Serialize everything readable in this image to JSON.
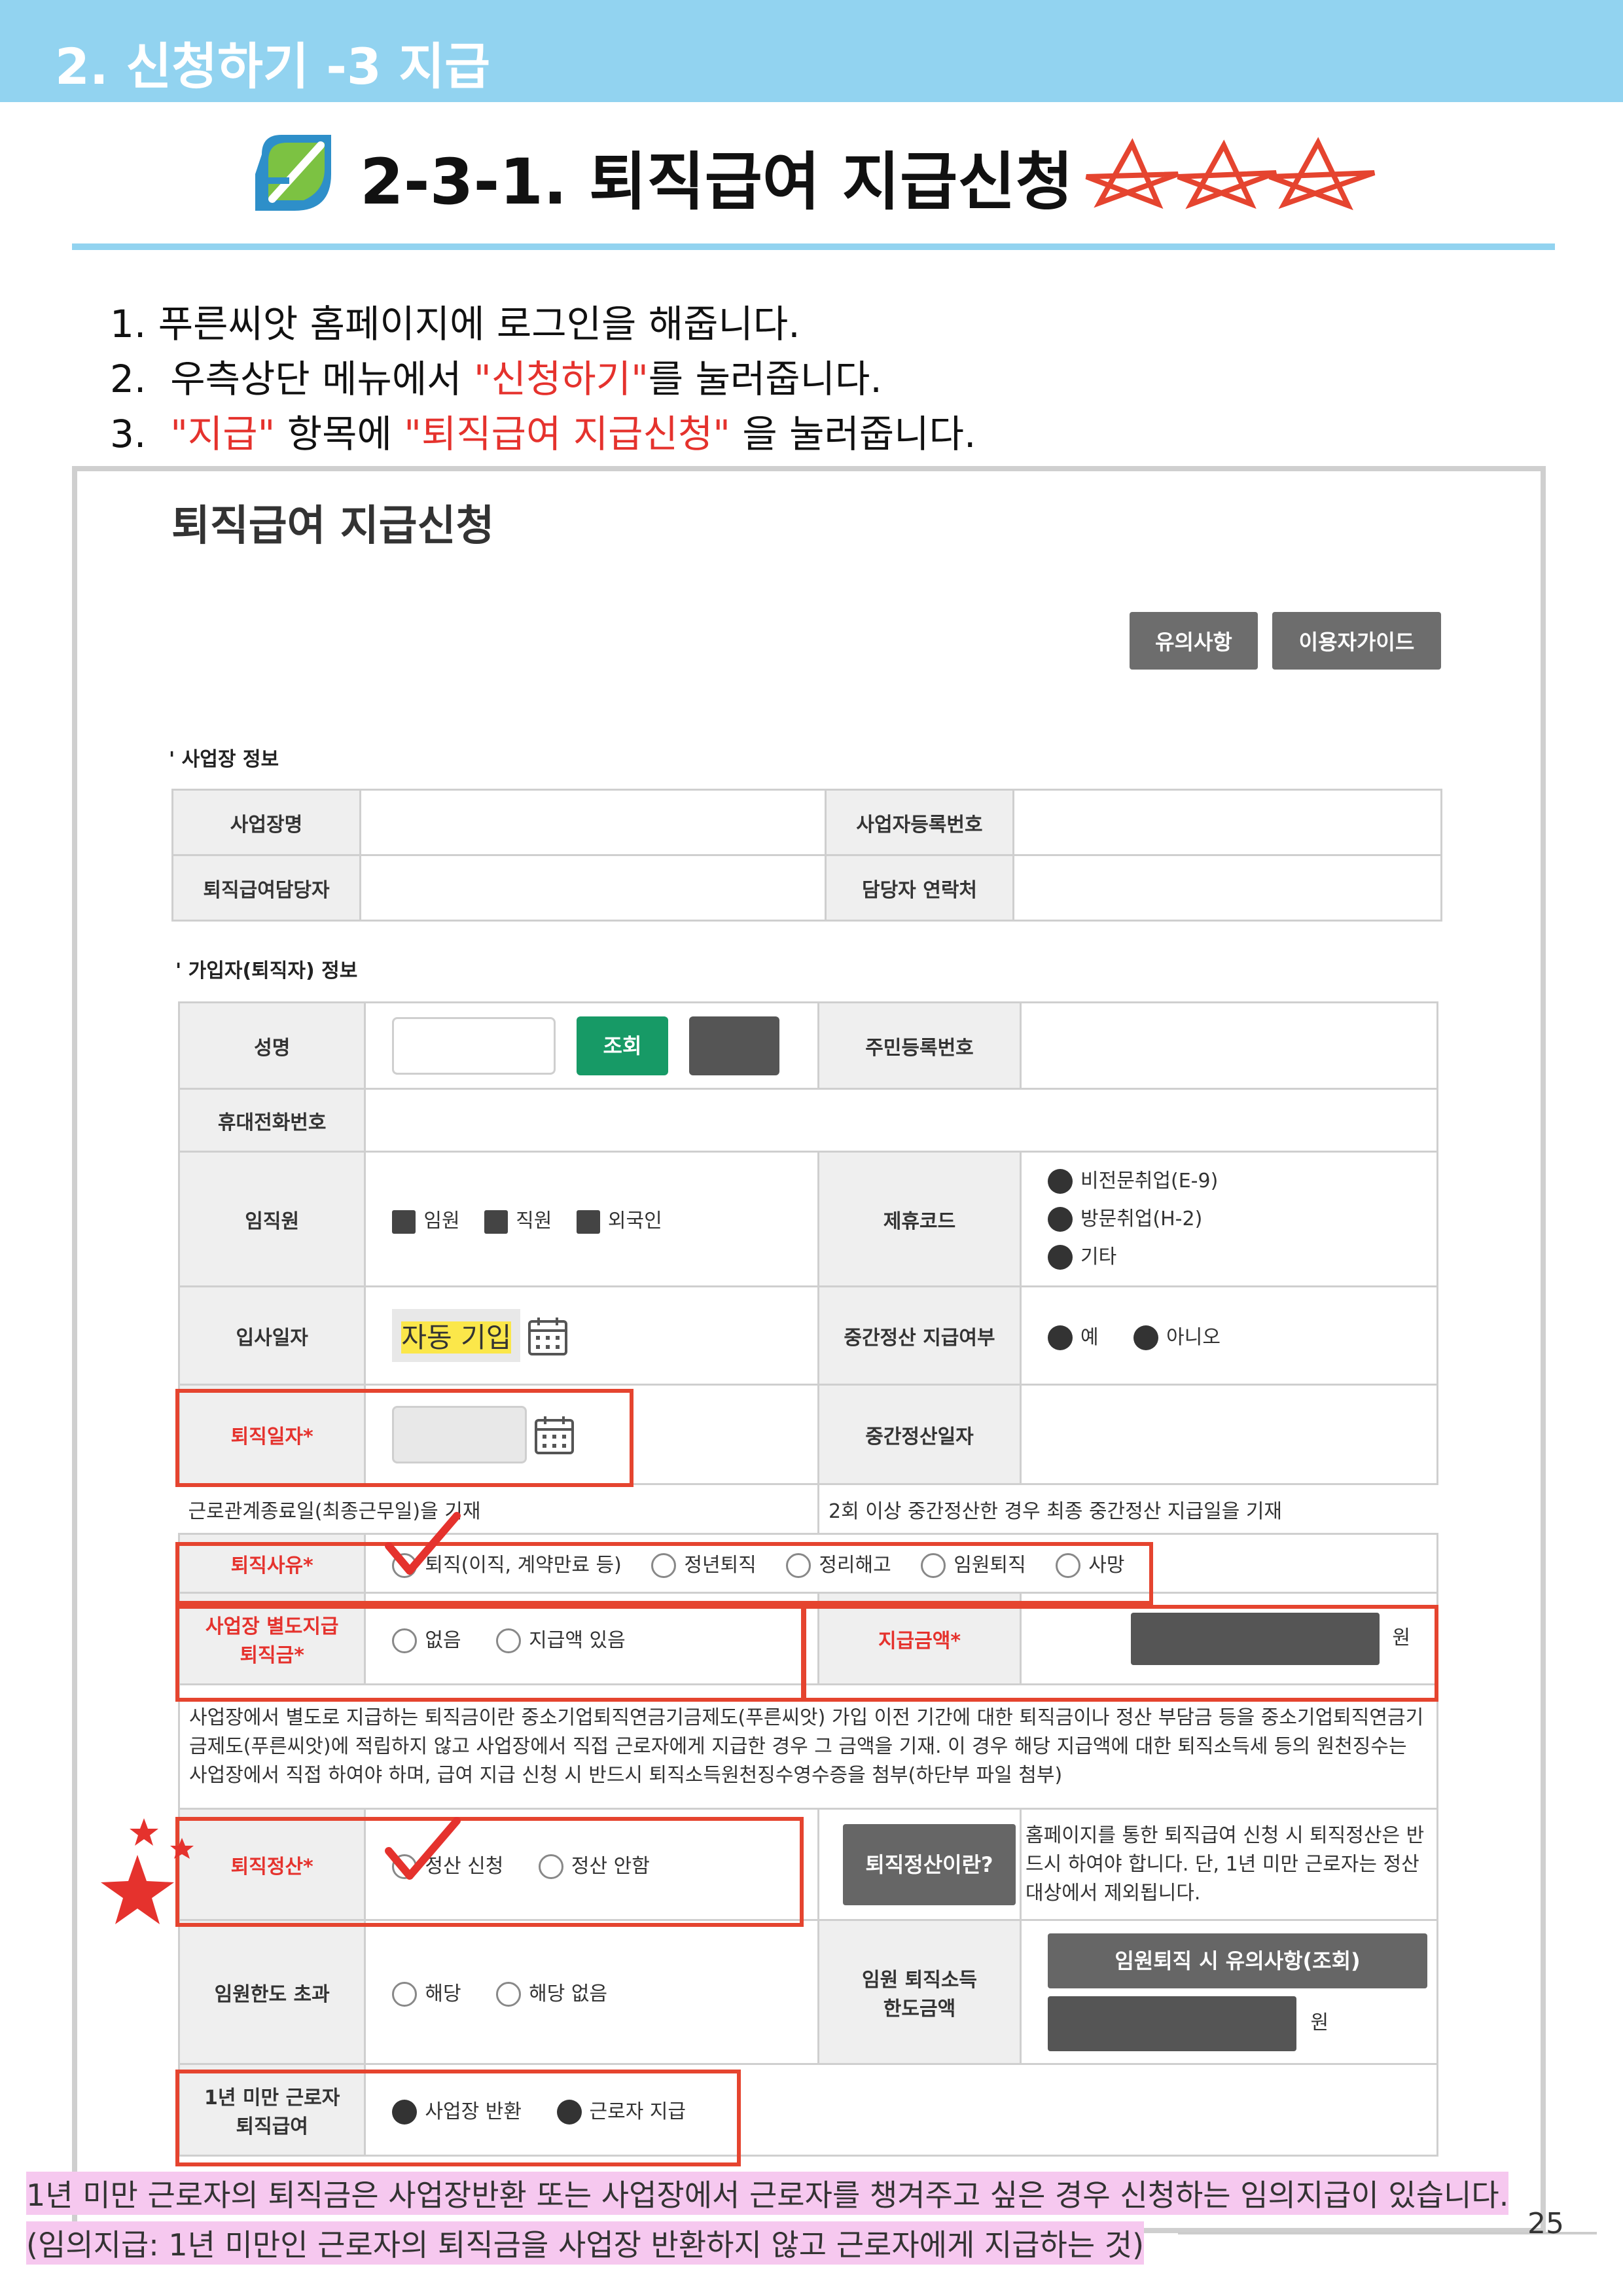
{
  "section_header": "2. 신청하기 -3 지급",
  "main_title": "2-3-1. 퇴직급여 지급신청",
  "steps": [
    {
      "num": "1.",
      "pre": "푸른씨앗 홈페이지에 로그인을 해줍니다.",
      "red1": "",
      "mid": "",
      "red2": "",
      "post": ""
    },
    {
      "num": "2.",
      "pre": "우측상단 메뉴에서 ",
      "red1": "\"신청하기\"",
      "mid": "를 눌러줍니다.",
      "red2": "",
      "post": ""
    },
    {
      "num": "3.",
      "pre": "",
      "red1": "\"지급\"",
      "mid": " 항목에 ",
      "red2": "\"퇴직급여 지급신청\"",
      "post": " 을 눌러줍니다."
    }
  ],
  "form": {
    "title": "퇴직급여 지급신청",
    "buttons": {
      "notice": "유의사항",
      "guide": "이용자가이드"
    },
    "workplace_section": "사업장 정보",
    "workplace": {
      "name_label": "사업장명",
      "bizno_label": "사업자등록번호",
      "manager_label": "퇴직급여담당자",
      "contact_label": "담당자 연락처"
    },
    "member_section": "가입자(퇴직자) 정보",
    "member": {
      "name_label": "성명",
      "lookup_button": "조회",
      "rrn_label": "주민등록번호",
      "phone_label": "휴대전화번호",
      "staff_label": "임직원",
      "staff_options": [
        "임원",
        "직원",
        "외국인"
      ],
      "code_label": "제휴코드",
      "code_options": [
        "비전문취업(E-9)",
        "방문취업(H-2)",
        "기타"
      ],
      "join_label": "입사일자",
      "join_value": "자동 기입",
      "interim_label": "중간정산 지급여부",
      "interim_options": [
        "예",
        "아니오"
      ],
      "retire_date_label": "퇴직일자",
      "required_mark": "*",
      "interim_date_label": "중간정산일자",
      "retire_date_note": "근로관계종료일(최종근무일)을 기재",
      "interim_date_note": "2회 이상 중간정산한 경우 최종 중간정산 지급일을 기재",
      "reason_label": "퇴직사유",
      "reason_options": [
        "퇴직(이직, 계약만료 등)",
        "정년퇴직",
        "정리해고",
        "임원퇴직",
        "사망"
      ],
      "separate_label_1": "사업장 별도지급",
      "separate_label_2": "퇴직금",
      "separate_options": [
        "없음",
        "지급액 있음"
      ],
      "amount_label": "지급금액",
      "amount_unit": "원",
      "separate_note": "사업장에서 별도로 지급하는 퇴직금이란 중소기업퇴직연금기금제도(푸른씨앗) 가입 이전 기간에 대한 퇴직금이나 정산 부담금 등을 중소기업퇴직연금기금제도(푸른씨앗)에 적립하지 않고 사업장에서 직접 근로자에게 지급한 경우 그 금액을 기재. 이 경우 해당 지급액에 대한 퇴직소득세 등의 원천징수는 사업장에서 직접 하여야 하며, 급여 지급 신청 시 반드시 퇴직소득원천징수영수증을 첨부(하단부 파일 첨부)",
      "settle_label": "퇴직정산",
      "settle_options": [
        "정산 신청",
        "정산 안함"
      ],
      "settle_what_button": "퇴직정산이란?",
      "settle_note": "홈페이지를 통한 퇴직급여 신청 시 퇴직정산은 반드시 하여야 합니다. 단, 1년 미만 근로자는 정산대상에서 제외됩니다.",
      "exec_limit_label": "임원한도 초과",
      "exec_limit_options": [
        "해당",
        "해당 없음"
      ],
      "exec_tax_label_1": "임원 퇴직소득",
      "exec_tax_label_2": "한도금액",
      "exec_notice_button": "임원퇴직 시 유의사항(조회)",
      "exec_unit": "원",
      "under1y_label_1": "1년 미만 근로자",
      "under1y_label_2": "퇴직급여",
      "under1y_options": [
        "사업장 반환",
        "근로자 지급"
      ]
    }
  },
  "bottom_note": [
    "1년 미만 근로자의 퇴직금은 사업장반환 또는 사업장에서 근로자를 챙겨주고 싶은 경우 신청하는 임의지급이 있습니다.",
    "(임의지급: 1년 미만인 근로자의 퇴직금을 사업장 반환하지 않고 근로자에게 지급하는 것)"
  ],
  "page_number": "25",
  "colors": {
    "header_bar": "#92d3f0",
    "accent_red": "#e5322d",
    "green_button": "#179a66",
    "highlight_pink": "#f6c8ef",
    "highlight_yellow": "#fbe74a"
  }
}
